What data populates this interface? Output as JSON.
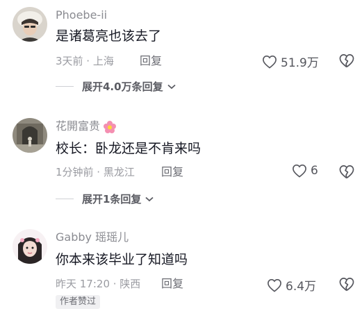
{
  "comments": [
    {
      "username": "Phoebe-ii",
      "text": "是诸葛亮也该去了",
      "meta": "3天前 · 上海",
      "reply_label": "回复",
      "likes": "51.9万",
      "expand_label": "展开4.0万条回复"
    },
    {
      "username": "花開富贵",
      "username_icon": "flower-icon",
      "text": "校长：卧龙还是不肯来吗",
      "meta": "1分钟前 · 黑龙江",
      "reply_label": "回复",
      "likes": "6",
      "expand_label": "展开1条回复"
    },
    {
      "username": "Gabby 瑶瑶儿",
      "text": "你本来该毕业了知道吗",
      "meta": "昨天 17:20 · 陕西",
      "reply_label": "回复",
      "likes": "6.4万",
      "badge": "作者赞过"
    }
  ],
  "icons": {
    "like": "heart-outline-icon",
    "dislike": "broken-heart-icon",
    "expand": "chevron-down-icon"
  },
  "colors": {
    "text": "#161823",
    "secondary": "#8a8b91",
    "flower": "#f06292"
  }
}
